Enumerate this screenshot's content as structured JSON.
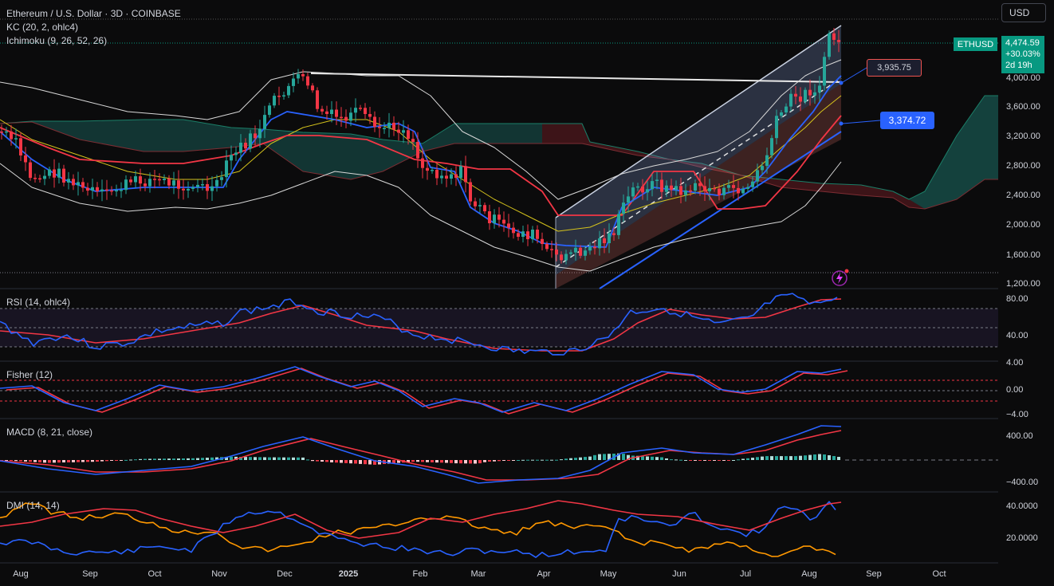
{
  "header": {
    "symbol_title": "Ethereum / U.S. Dollar · 3D · COINBASE",
    "indicator_kc": "KC (20, 2, ohlc4)",
    "indicator_ichimoku": "Ichimoku (9, 26, 52, 26)"
  },
  "currency_button": "USD",
  "price_tag": {
    "symbol": "ETHUSD",
    "price": "4,474.59",
    "change": "+30.03%",
    "countdown": "2d 19h"
  },
  "labels": {
    "upper": "3,935.75",
    "lower": "3,374.72"
  },
  "price_axis": [
    "4,000.00",
    "3,600.00",
    "3,200.00",
    "2,800.00",
    "2,400.00",
    "2,000.00",
    "1,600.00",
    "1,200.00"
  ],
  "panes": {
    "rsi": {
      "title": "RSI (14, ohlc4)",
      "ticks": [
        "80.00",
        "40.00"
      ]
    },
    "fisher": {
      "title": "Fisher (12)",
      "ticks": [
        "4.00",
        "0.00",
        "−4.00"
      ]
    },
    "macd": {
      "title": "MACD (8, 21, close)",
      "ticks": [
        "400.00",
        "−400.00"
      ]
    },
    "dmi": {
      "title": "DMI (14, 14)",
      "ticks": [
        "40.0000",
        "20.0000"
      ]
    }
  },
  "time_axis": [
    "Aug",
    "Sep",
    "Oct",
    "Nov",
    "Dec",
    "2025",
    "Feb",
    "Mar",
    "Apr",
    "May",
    "Jun",
    "Jul",
    "Aug",
    "Sep",
    "Oct"
  ],
  "colors": {
    "up": "#26a69a",
    "down": "#f23645",
    "blue": "#2962ff",
    "red": "#f23645",
    "orange": "#ff9800",
    "yellow": "#d4c21c"
  },
  "icons": {
    "replay": "lightning-icon"
  }
}
